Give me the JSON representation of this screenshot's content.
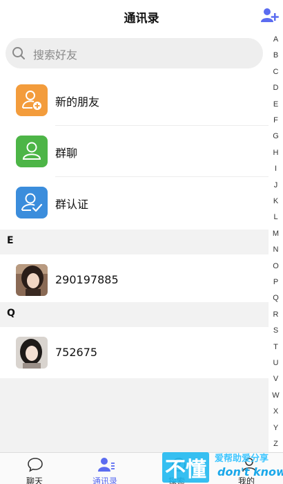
{
  "header": {
    "title": "通讯录",
    "add_icon": "add-contact-icon"
  },
  "search": {
    "placeholder": "搜索好友",
    "icon": "search-icon"
  },
  "menu": [
    {
      "label": "新的朋友",
      "icon": "new-friend-icon",
      "color": "#F39C3C"
    },
    {
      "label": "群聊",
      "icon": "group-chat-icon",
      "color": "#4DB547"
    },
    {
      "label": "群认证",
      "icon": "group-verify-icon",
      "color": "#3B8DDC"
    }
  ],
  "sections": [
    {
      "letter": "E",
      "contacts": [
        {
          "name": "290197885"
        }
      ]
    },
    {
      "letter": "Q",
      "contacts": [
        {
          "name": "752675"
        }
      ]
    }
  ],
  "index_letters": [
    "A",
    "B",
    "C",
    "D",
    "E",
    "F",
    "G",
    "H",
    "I",
    "J",
    "K",
    "L",
    "M",
    "N",
    "O",
    "P",
    "Q",
    "R",
    "S",
    "T",
    "U",
    "V",
    "W",
    "X",
    "Y",
    "Z"
  ],
  "tabs": [
    {
      "label": "聊天",
      "icon": "chat-bubble-icon",
      "active": false
    },
    {
      "label": "通讯录",
      "icon": "contacts-icon",
      "active": true
    },
    {
      "label": "探索",
      "icon": "explore-icon",
      "active": false
    },
    {
      "label": "我的",
      "icon": "profile-icon",
      "active": false
    }
  ],
  "watermark": {
    "text_main": "不懂",
    "text_side": "爱帮助爱分享",
    "text_sub": "don't know"
  },
  "colors": {
    "accent": "#5B6CF0",
    "background": "#F2F2F2",
    "divider": "#ECECEC"
  }
}
